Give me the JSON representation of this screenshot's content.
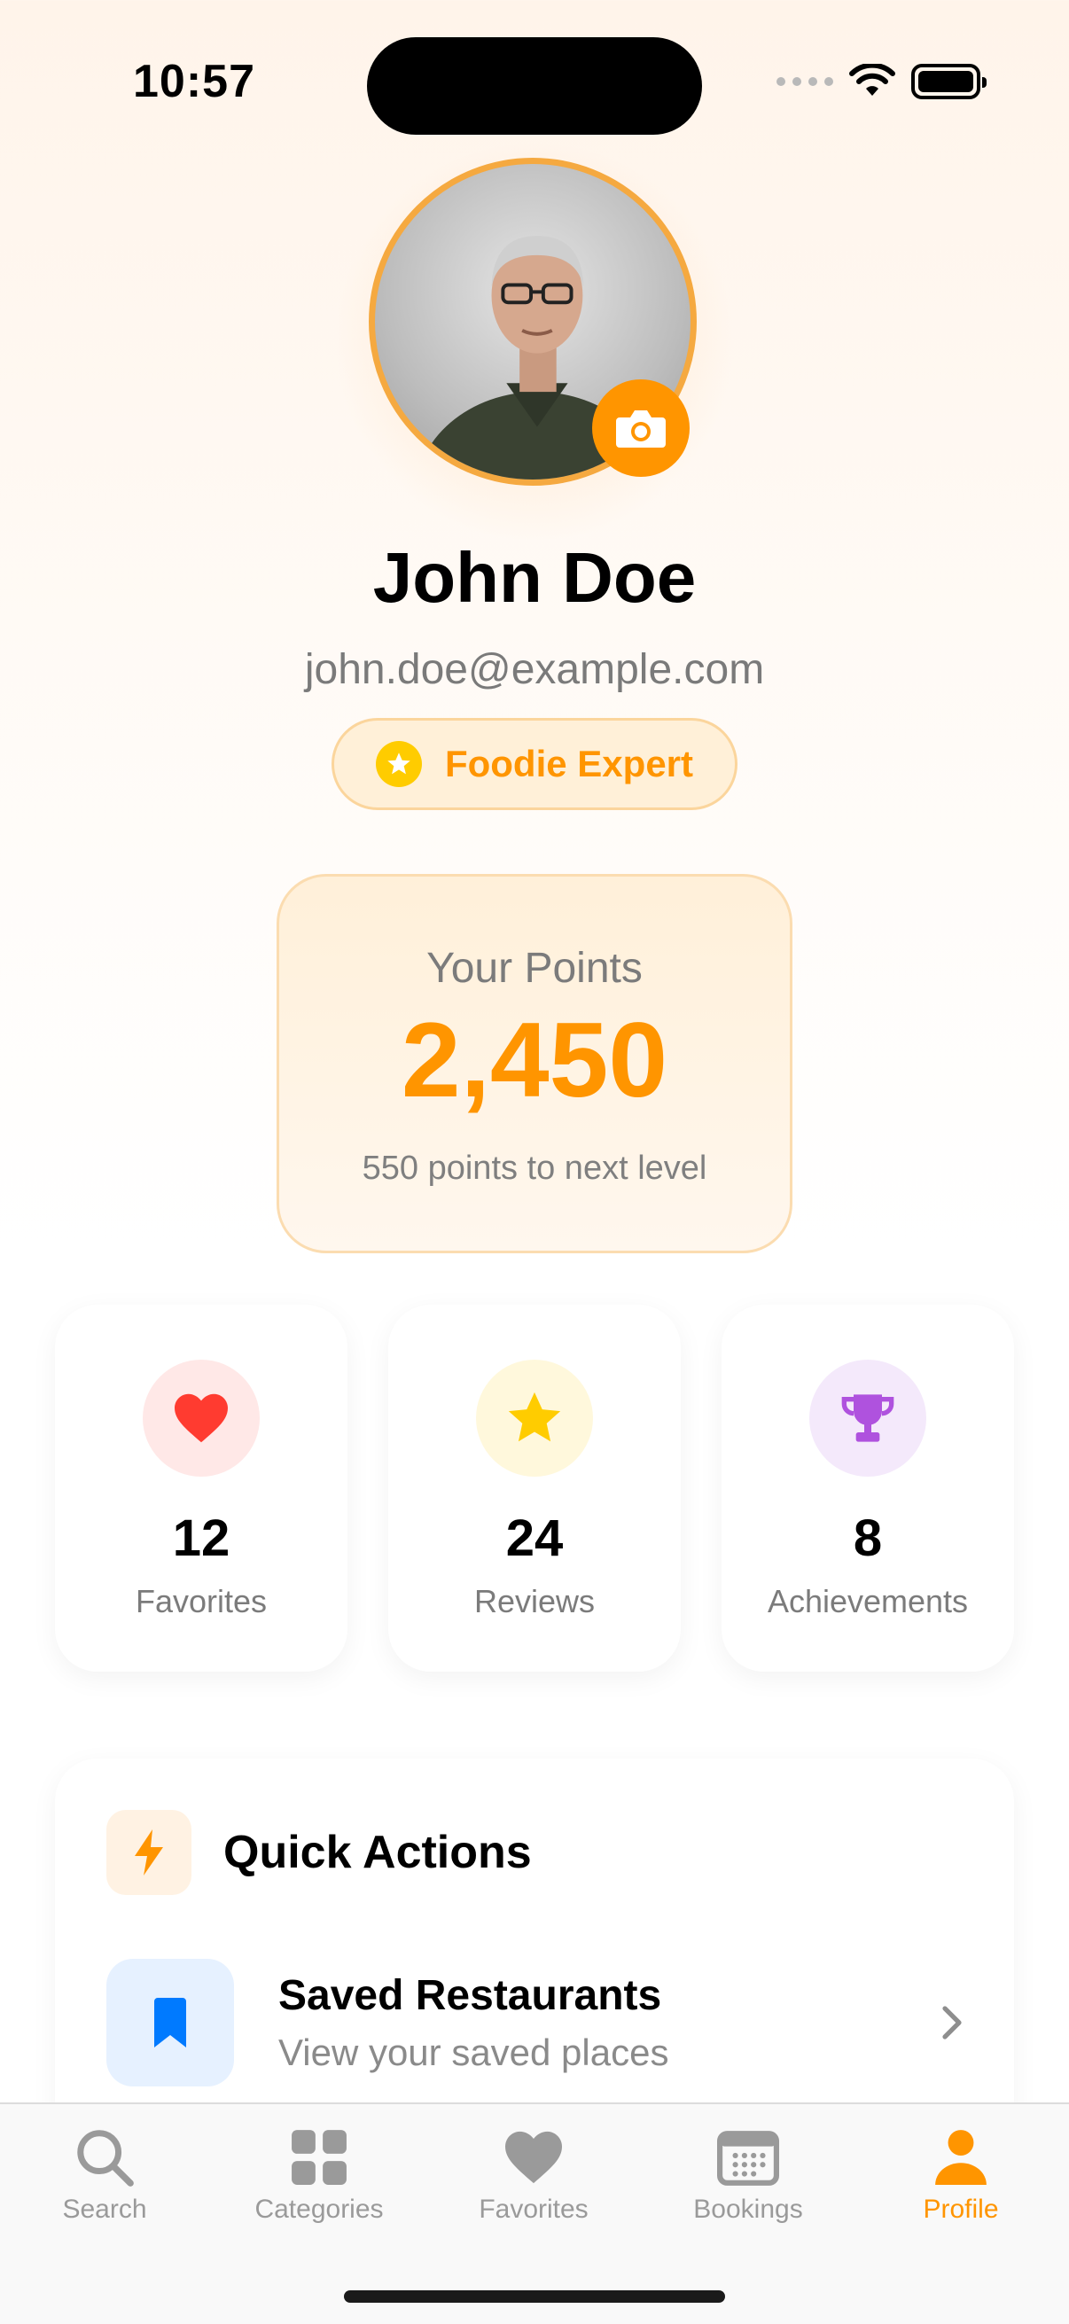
{
  "status_bar": {
    "time": "10:57"
  },
  "profile": {
    "name": "John Doe",
    "email": "john.doe@example.com",
    "badge": "Foodie Expert",
    "avatar_icon": "user-photo",
    "camera_icon": "camera-icon"
  },
  "points": {
    "label": "Your Points",
    "value": "2,450",
    "subtitle": "550 points to next level"
  },
  "stats": [
    {
      "value": "12",
      "label": "Favorites",
      "icon": "heart-icon",
      "color": "#ff3b30",
      "bg": "#ffe8e7"
    },
    {
      "value": "24",
      "label": "Reviews",
      "icon": "star-icon",
      "color": "#ffcc00",
      "bg": "#fff8dc"
    },
    {
      "value": "8",
      "label": "Achievements",
      "icon": "trophy-icon",
      "color": "#af52de",
      "bg": "#f4e9fb"
    }
  ],
  "quick_actions": {
    "title": "Quick Actions",
    "items": [
      {
        "title": "Saved Restaurants",
        "subtitle": "View your saved places",
        "icon": "bookmark-icon"
      }
    ]
  },
  "tabs": [
    {
      "label": "Search",
      "icon": "search-icon",
      "active": false
    },
    {
      "label": "Categories",
      "icon": "grid-icon",
      "active": false
    },
    {
      "label": "Favorites",
      "icon": "heart-icon",
      "active": false
    },
    {
      "label": "Bookings",
      "icon": "calendar-icon",
      "active": false
    },
    {
      "label": "Profile",
      "icon": "person-icon",
      "active": true
    }
  ],
  "colors": {
    "accent": "#ff9500",
    "inactive": "#9a9a9a",
    "blue": "#007aff"
  }
}
